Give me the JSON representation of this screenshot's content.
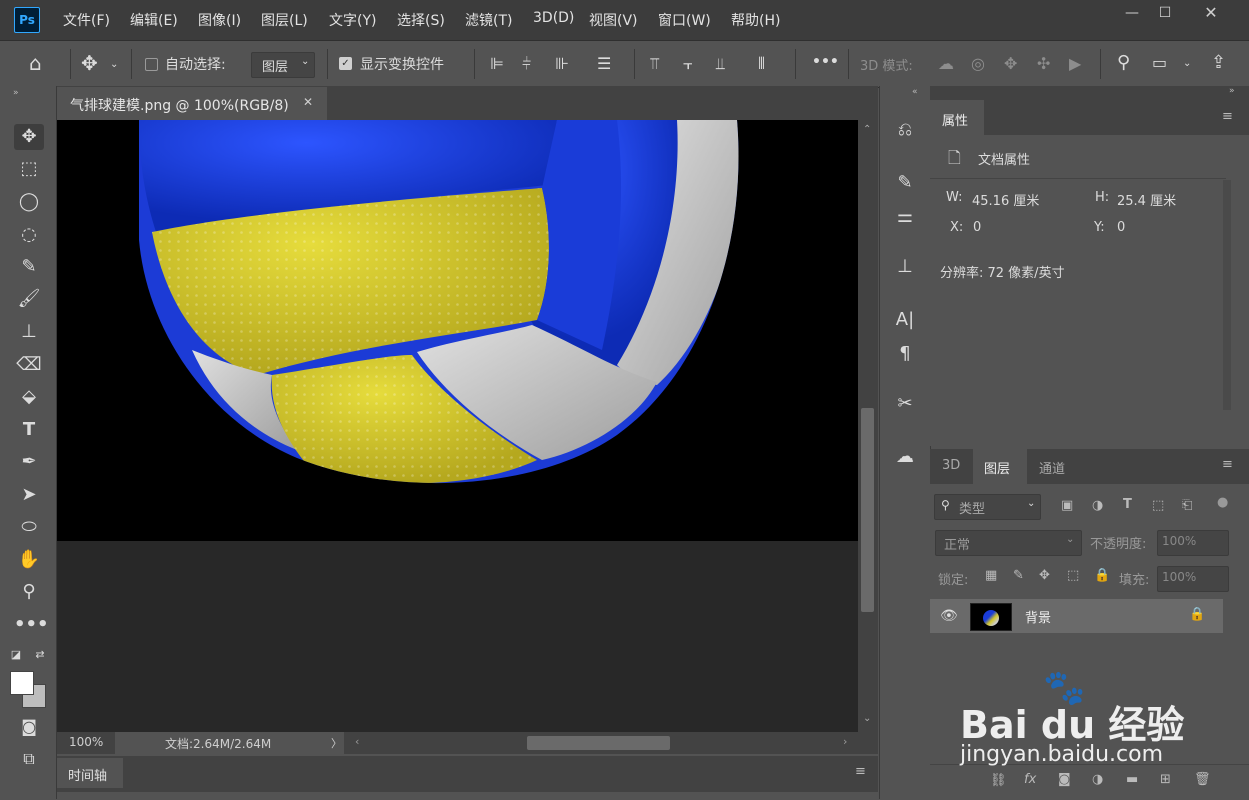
{
  "app": {
    "logo": "Ps"
  },
  "menu": [
    "文件(F)",
    "编辑(E)",
    "图像(I)",
    "图层(L)",
    "文字(Y)",
    "选择(S)",
    "滤镜(T)",
    "3D(D)",
    "视图(V)",
    "窗口(W)",
    "帮助(H)"
  ],
  "window_controls": {
    "minimize": "—",
    "maximize": "☐",
    "close": "✕"
  },
  "options": {
    "auto_select_label": "自动选择:",
    "auto_select_target": "图层",
    "show_transform_label": "显示变换控件",
    "show_transform_checked": true,
    "more": "•••",
    "mode_3d_label": "3D 模式:"
  },
  "document": {
    "tab_title": "气排球建模.png @ 100%(RGB/8)",
    "tab_close": "✕",
    "zoom": "100%",
    "doc_size": "文档:2.64M/2.64M",
    "status_arrow": "〉"
  },
  "timeline": {
    "label": "时间轴"
  },
  "properties": {
    "tab": "属性",
    "section": "文档属性",
    "w_label": "W:",
    "w_value": "45.16 厘米",
    "h_label": "H:",
    "h_value": "25.4 厘米",
    "x_label": "X:",
    "x_value": "0",
    "y_label": "Y:",
    "y_value": "0",
    "resolution": "分辨率: 72 像素/英寸"
  },
  "layers_panel": {
    "tabs": [
      "3D",
      "图层",
      "通道"
    ],
    "active_tab": "图层",
    "filter_kind": "类型",
    "blend_mode": "正常",
    "opacity_label": "不透明度:",
    "opacity_value": "100%",
    "lock_label": "锁定:",
    "fill_label": "填充:",
    "fill_value": "100%",
    "layers": [
      {
        "name": "背景",
        "visible": true,
        "locked": true
      }
    ]
  },
  "watermark": {
    "brand": "Bai du 经验",
    "url": "jingyan.baidu.com"
  },
  "colors": {
    "accent": "#31a8ff",
    "ball_blue": "#1a3fd0",
    "ball_yellow": "#d2c62a",
    "ball_white": "#cfcfcf"
  }
}
